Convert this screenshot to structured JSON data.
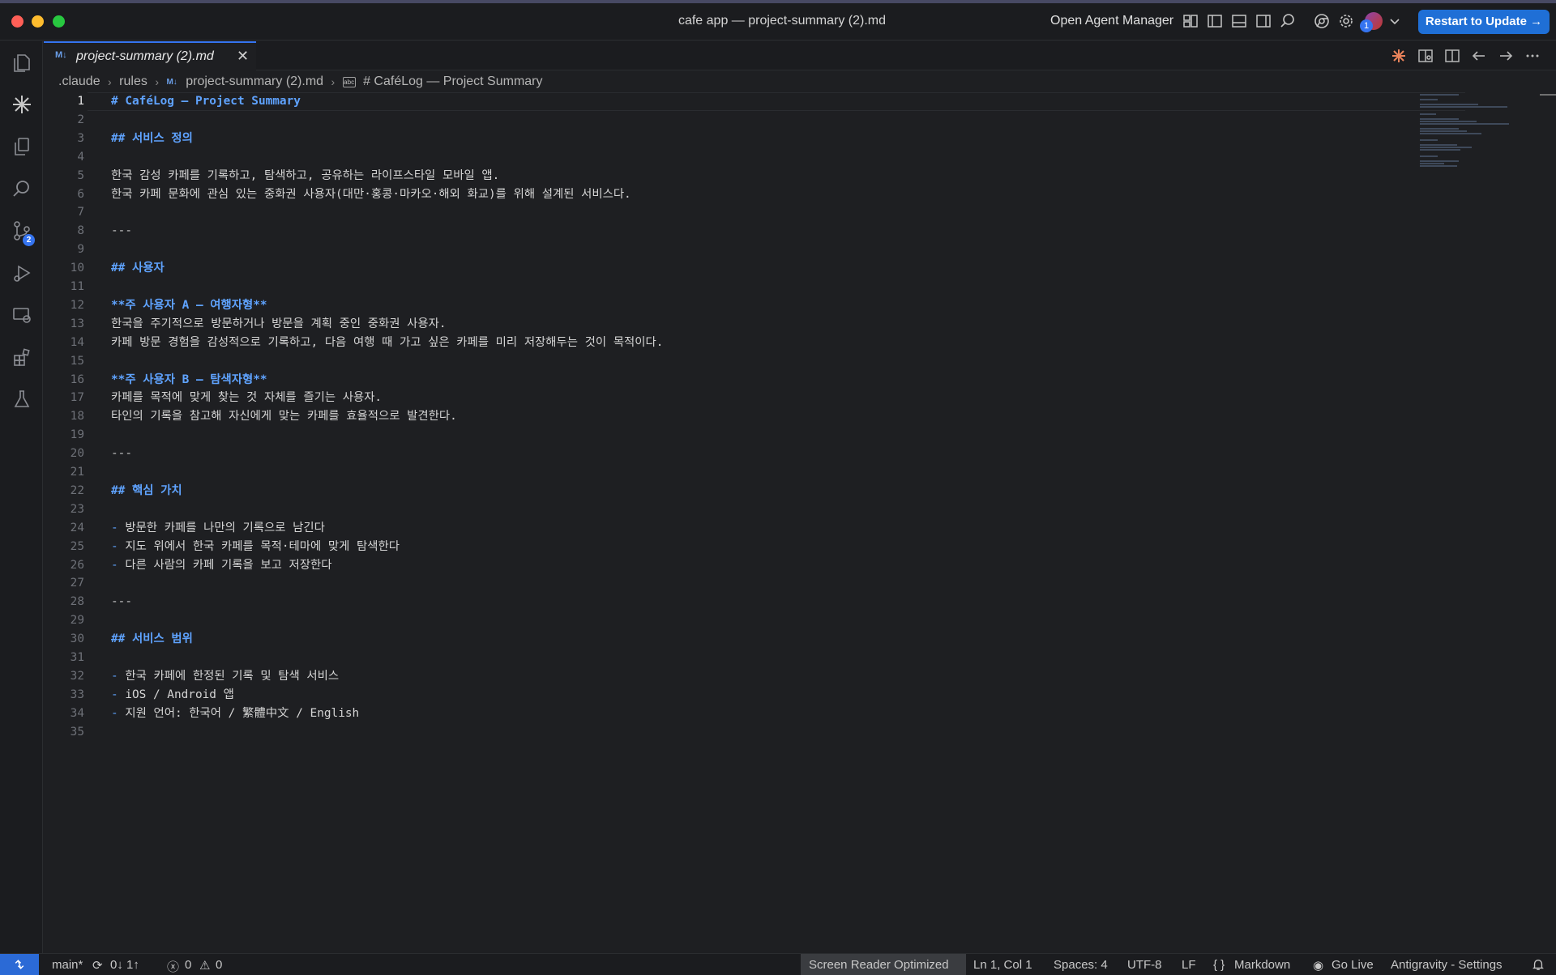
{
  "window": {
    "title": "cafe app — project-summary (2).md",
    "agent_manager": "Open Agent Manager",
    "restart_label": "Restart to Update →",
    "avatar_badge": "1"
  },
  "activity_bar": {
    "source_control_badge": "2"
  },
  "tab": {
    "icon": "M↓",
    "label": "project-summary (2).md",
    "close": "✕"
  },
  "breadcrumb": {
    "items": [
      ".claude",
      "rules",
      "project-summary (2).md",
      "# CaféLog — Project Summary"
    ],
    "md_icon": "M↓",
    "symbol_icon": "abc",
    "sep": "›"
  },
  "editor": {
    "active_line": 1,
    "lines": [
      {
        "n": "1",
        "text": "# CaféLog — Project Summary",
        "kind": "h1"
      },
      {
        "n": "2",
        "text": "",
        "kind": "text"
      },
      {
        "n": "3",
        "text": "## 서비스 정의",
        "kind": "h2"
      },
      {
        "n": "4",
        "text": "",
        "kind": "text"
      },
      {
        "n": "5",
        "text": "한국 감성 카페를 기록하고, 탐색하고, 공유하는 라이프스타일 모바일 앱.",
        "kind": "text"
      },
      {
        "n": "6",
        "text": "한국 카페 문화에 관심 있는 중화권 사용자(대만·홍콩·마카오·해외 화교)를 위해 설계된 서비스다.",
        "kind": "text"
      },
      {
        "n": "7",
        "text": "",
        "kind": "text"
      },
      {
        "n": "8",
        "text": "---",
        "kind": "hr"
      },
      {
        "n": "9",
        "text": "",
        "kind": "text"
      },
      {
        "n": "10",
        "text": "## 사용자",
        "kind": "h2"
      },
      {
        "n": "11",
        "text": "",
        "kind": "text"
      },
      {
        "n": "12",
        "text": "**주 사용자 A — 여행자형**",
        "kind": "bold"
      },
      {
        "n": "13",
        "text": "한국을 주기적으로 방문하거나 방문을 계획 중인 중화권 사용자.",
        "kind": "text"
      },
      {
        "n": "14",
        "text": "카페 방문 경험을 감성적으로 기록하고, 다음 여행 때 가고 싶은 카페를 미리 저장해두는 것이 목적이다.",
        "kind": "text"
      },
      {
        "n": "15",
        "text": "",
        "kind": "text"
      },
      {
        "n": "16",
        "text": "**주 사용자 B — 탐색자형**",
        "kind": "bold"
      },
      {
        "n": "17",
        "text": "카페를 목적에 맞게 찾는 것 자체를 즐기는 사용자.",
        "kind": "text"
      },
      {
        "n": "18",
        "text": "타인의 기록을 참고해 자신에게 맞는 카페를 효율적으로 발견한다.",
        "kind": "text"
      },
      {
        "n": "19",
        "text": "",
        "kind": "text"
      },
      {
        "n": "20",
        "text": "---",
        "kind": "hr"
      },
      {
        "n": "21",
        "text": "",
        "kind": "text"
      },
      {
        "n": "22",
        "text": "## 핵심 가치",
        "kind": "h2"
      },
      {
        "n": "23",
        "text": "",
        "kind": "text"
      },
      {
        "n": "24",
        "text": "방문한 카페를 나만의 기록으로 남긴다",
        "kind": "bullet"
      },
      {
        "n": "25",
        "text": "지도 위에서 한국 카페를 목적·테마에 맞게 탐색한다",
        "kind": "bullet"
      },
      {
        "n": "26",
        "text": "다른 사람의 카페 기록을 보고 저장한다",
        "kind": "bullet"
      },
      {
        "n": "27",
        "text": "",
        "kind": "text"
      },
      {
        "n": "28",
        "text": "---",
        "kind": "hr"
      },
      {
        "n": "29",
        "text": "",
        "kind": "text"
      },
      {
        "n": "30",
        "text": "## 서비스 범위",
        "kind": "h2"
      },
      {
        "n": "31",
        "text": "",
        "kind": "text"
      },
      {
        "n": "32",
        "text": "한국 카페에 한정된 기록 및 탐색 서비스",
        "kind": "bullet"
      },
      {
        "n": "33",
        "text": "iOS / Android 앱",
        "kind": "bullet"
      },
      {
        "n": "34",
        "text": "지원 언어: 한국어 / 繁體中文 / English",
        "kind": "bullet"
      },
      {
        "n": "35",
        "text": "",
        "kind": "text"
      }
    ]
  },
  "statusbar": {
    "remote_icon": "remote-icon",
    "branch": "main*",
    "sync": "0↓ 1↑",
    "errors": "0",
    "warnings": "0",
    "screen_reader": "Screen Reader Optimized",
    "position": "Ln 1, Col 1",
    "spaces": "Spaces: 4",
    "encoding": "UTF-8",
    "eol": "LF",
    "language": "Markdown",
    "go_live": "Go Live",
    "settings": "Antigravity - Settings"
  },
  "colors": {
    "accent": "#3574f0",
    "markdown_heading": "#5fa3ff",
    "editor_bg": "#1e1f22"
  }
}
